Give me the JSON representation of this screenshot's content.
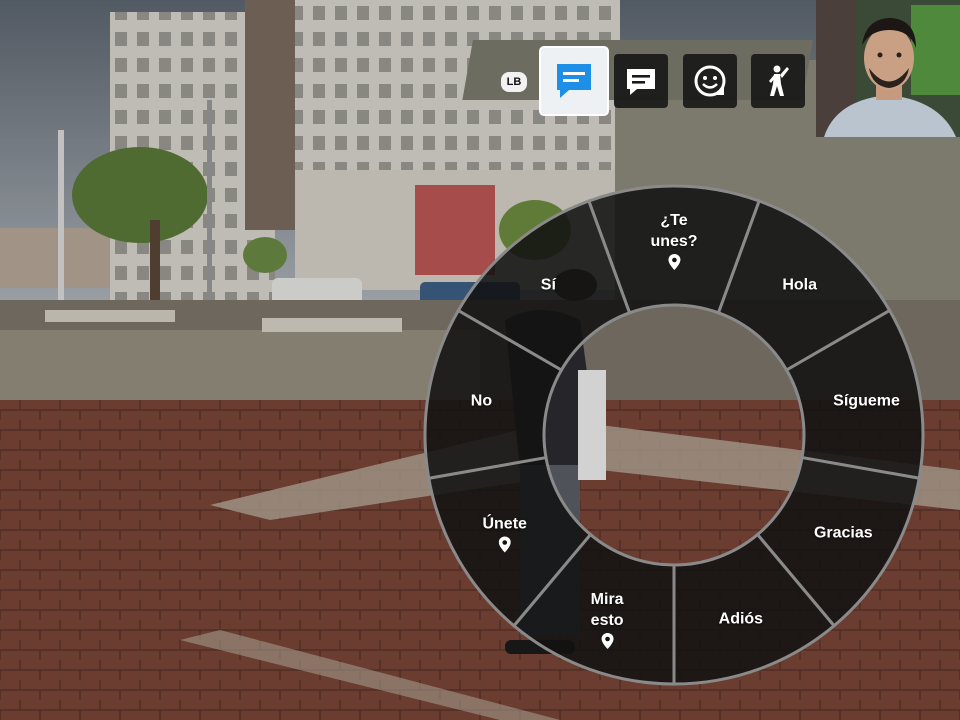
{
  "tabs": {
    "lb_label": "LB",
    "items": [
      {
        "icon": "chat-bubble-icon",
        "active": true
      },
      {
        "icon": "message-icon",
        "active": false
      },
      {
        "icon": "sticker-emote-icon",
        "active": false
      },
      {
        "icon": "player-gesture-icon",
        "active": false
      }
    ]
  },
  "wheel": {
    "segments": [
      {
        "label": "¿Te\nunes?",
        "pin": true
      },
      {
        "label": "Hola",
        "pin": false
      },
      {
        "label": "Sígueme",
        "pin": false
      },
      {
        "label": "Gracias",
        "pin": false
      },
      {
        "label": "Adiós",
        "pin": false
      },
      {
        "label": "Mira\nesto",
        "pin": true
      },
      {
        "label": "Únete",
        "pin": true
      },
      {
        "label": "No",
        "pin": false
      },
      {
        "label": "Sí",
        "pin": false
      }
    ]
  },
  "colors": {
    "wheel_fill": "#121212",
    "divider": "#8a8a8a",
    "active_tab": "#1e8fe6",
    "brick": "#7c4a3a",
    "sky": "#9aa3ad"
  },
  "webcam": {
    "label": "streamer webcam overlay"
  }
}
